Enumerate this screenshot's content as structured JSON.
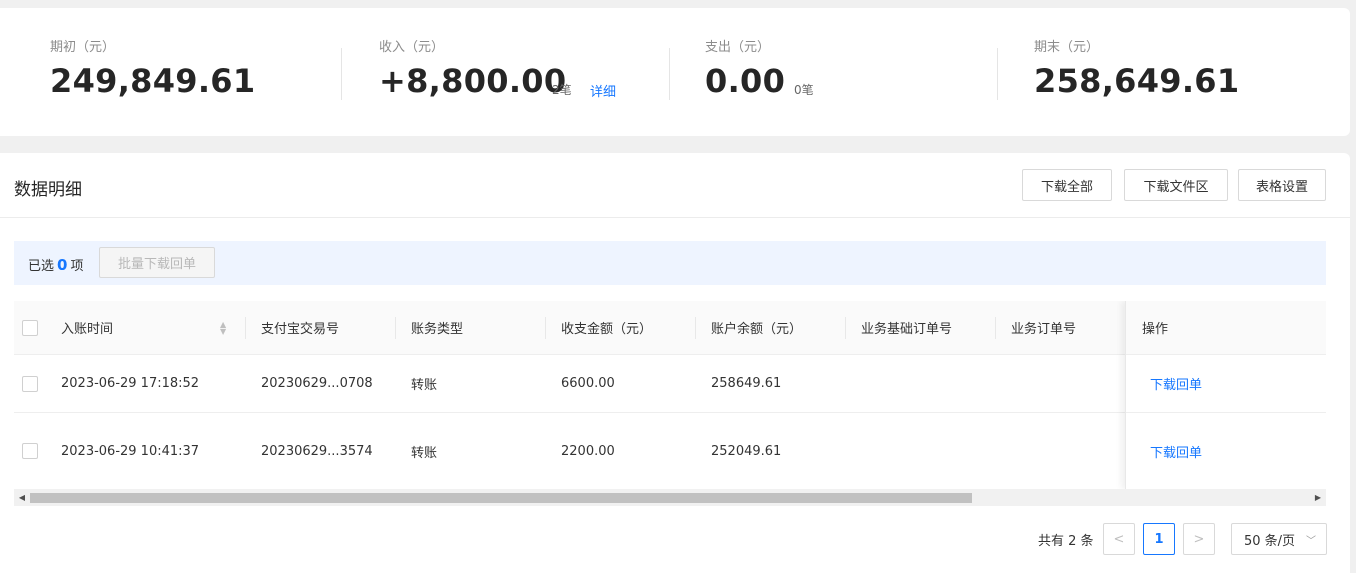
{
  "summary": {
    "opening": {
      "label": "期初（元）",
      "value": "249,849.61"
    },
    "income": {
      "label": "收入（元）",
      "value": "+8,800.00",
      "count": "2笔",
      "detail": "详细"
    },
    "expense": {
      "label": "支出（元）",
      "value": "0.00",
      "count": "0笔"
    },
    "closing": {
      "label": "期末（元）",
      "value": "258,649.61"
    }
  },
  "panel": {
    "title": "数据明细",
    "buttons": {
      "download_all": "下载全部",
      "download_files": "下载文件区",
      "table_settings": "表格设置"
    }
  },
  "selection": {
    "prefix": "已选",
    "count": "0",
    "suffix": "项",
    "batch_button": "批量下载回单"
  },
  "table": {
    "headers": [
      "入账时间",
      "支付宝交易号",
      "账务类型",
      "收支金额（元）",
      "账户余额（元）",
      "业务基础订单号",
      "业务订单号",
      "操作"
    ],
    "rows": [
      {
        "time": "2023-06-29 17:18:52",
        "trade_no": "20230629...0708",
        "type": "转账",
        "amount": "6600.00",
        "balance": "258649.61",
        "base_order": "",
        "order": "",
        "action": "下载回单"
      },
      {
        "time": "2023-06-29 10:41:37",
        "trade_no": "20230629...3574",
        "type": "转账",
        "amount": "2200.00",
        "balance": "252049.61",
        "base_order": "",
        "order": "",
        "action": "下载回单"
      }
    ]
  },
  "pagination": {
    "total": "共有 2 条",
    "prev": "<",
    "current": "1",
    "next": ">",
    "page_size": "50 条/页"
  },
  "icons": {
    "sort": "sort-icon",
    "chevron": "chevron-down-icon"
  },
  "colors": {
    "accent": "#1677ff",
    "selection_bg": "#eef4ff"
  }
}
